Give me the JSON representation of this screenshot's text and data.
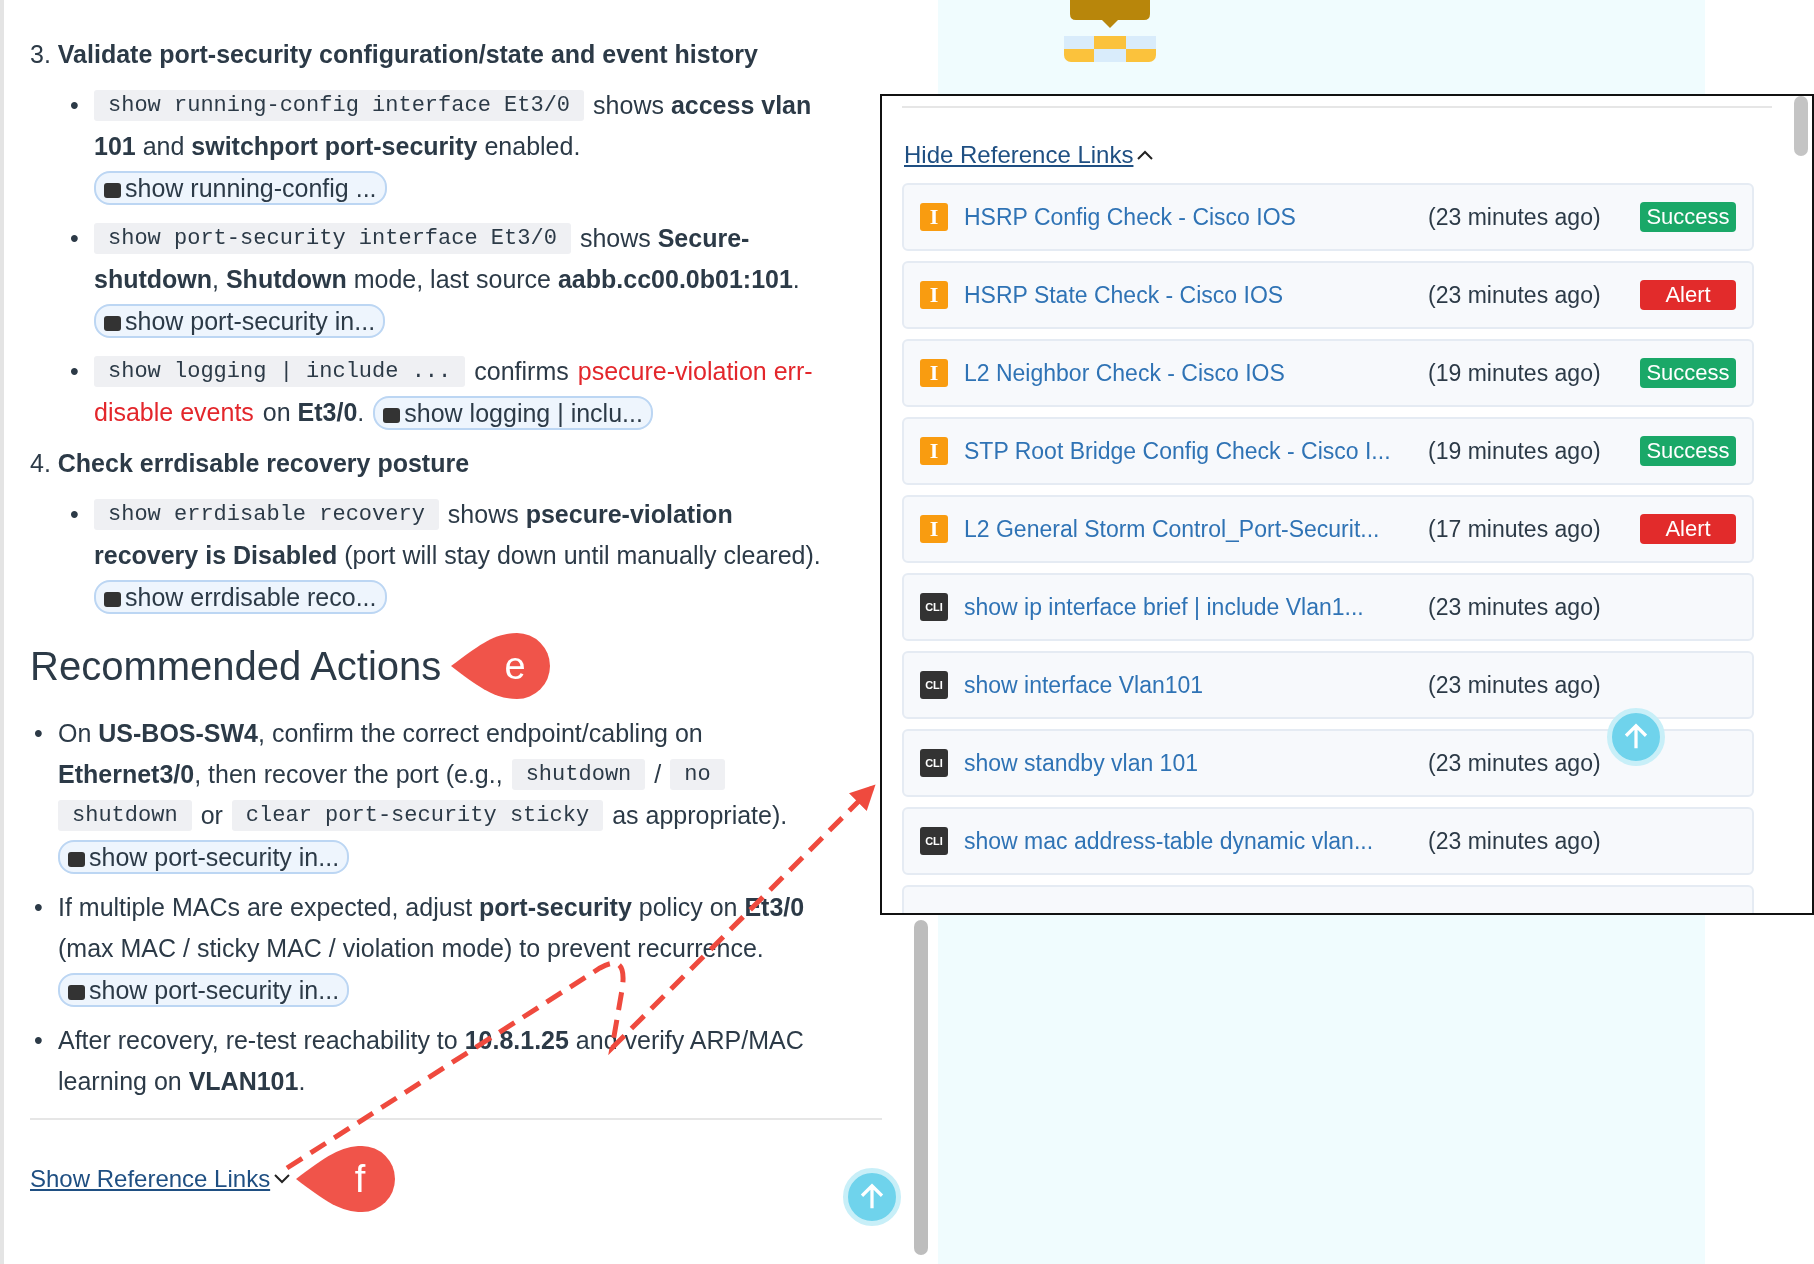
{
  "steps": [
    {
      "number": "3.",
      "title": "Validate port-security configuration/state and event history",
      "bullets": [
        {
          "marker": "•",
          "lines": [
            [
              {
                "kind": "code",
                "text": "show running-config interface Et3/0"
              },
              {
                "kind": "text",
                "text": "shows **access vlan**"
              }
            ],
            [
              {
                "kind": "text",
                "text": "**101** and **switchport port-security** enabled."
              }
            ],
            [
              {
                "kind": "chip",
                "text": "show running-config ..."
              }
            ]
          ]
        },
        {
          "marker": "•",
          "lines": [
            [
              {
                "kind": "code",
                "text": "show port-security interface Et3/0"
              },
              {
                "kind": "text",
                "text": "shows **Secure-**"
              }
            ],
            [
              {
                "kind": "text",
                "text": "**shutdown**, **Shutdown** mode, last source **aabb.cc00.0b01:101**."
              }
            ],
            [
              {
                "kind": "chip",
                "text": "show port-security in..."
              }
            ]
          ]
        },
        {
          "marker": "•",
          "lines": [
            [
              {
                "kind": "code",
                "text": "show logging | include ..."
              },
              {
                "kind": "text",
                "text": "confirms"
              },
              {
                "kind": "alert",
                "text": "psecure-violation err-"
              }
            ],
            [
              {
                "kind": "alert",
                "text": "disable events"
              },
              {
                "kind": "text",
                "text": "on **Et3/0**."
              },
              {
                "kind": "chip",
                "text": "show logging | inclu..."
              }
            ]
          ]
        }
      ]
    },
    {
      "number": "4.",
      "title": "Check errdisable recovery posture",
      "bullets": [
        {
          "marker": "•",
          "lines": [
            [
              {
                "kind": "code",
                "text": "show errdisable recovery"
              },
              {
                "kind": "text",
                "text": "shows **psecure-violation**"
              }
            ],
            [
              {
                "kind": "text",
                "text": "**recovery is Disabled** (port will stay down until manually cleared)."
              }
            ],
            [
              {
                "kind": "chip",
                "text": "show errdisable reco..."
              }
            ]
          ]
        }
      ]
    }
  ],
  "actions": {
    "heading": "Recommended Actions",
    "callout": "e",
    "bullets": [
      {
        "marker": "•",
        "lines": [
          [
            {
              "kind": "text",
              "text": "On **US-BOS-SW4**, confirm the correct endpoint/cabling on"
            }
          ],
          [
            {
              "kind": "text",
              "text": "**Ethernet3/0**, then recover the port (e.g.,"
            },
            {
              "kind": "code",
              "text": "shutdown"
            },
            {
              "kind": "text",
              "text": "/"
            },
            {
              "kind": "code",
              "text": "no"
            }
          ],
          [
            {
              "kind": "code",
              "text": "shutdown"
            },
            {
              "kind": "text",
              "text": "or"
            },
            {
              "kind": "code",
              "text": "clear port-security sticky"
            },
            {
              "kind": "text",
              "text": "as appropriate)."
            }
          ],
          [
            {
              "kind": "chip",
              "text": "show port-security in..."
            }
          ]
        ]
      },
      {
        "marker": "•",
        "lines": [
          [
            {
              "kind": "text",
              "text": "If multiple MACs are expected, adjust **port-security** policy on **Et3/0**"
            }
          ],
          [
            {
              "kind": "text",
              "text": "(max MAC / sticky MAC / violation mode) to prevent recurrence."
            }
          ],
          [
            {
              "kind": "chip",
              "text": "show port-security in..."
            }
          ]
        ]
      },
      {
        "marker": "•",
        "lines": [
          [
            {
              "kind": "text",
              "text": "After recovery, re-test reachability to **10.8.1.25** and verify ARP/MAC"
            }
          ],
          [
            {
              "kind": "text",
              "text": "learning on **VLAN101**."
            }
          ]
        ]
      }
    ]
  },
  "show_links": {
    "label": "Show Reference Links",
    "callout": "f"
  },
  "panel": {
    "toggle": "Hide Reference Links",
    "links": [
      {
        "kind": "check",
        "badge": "I",
        "title": "HSRP Config Check - Cisco IOS",
        "time": "(23 minutes ago)",
        "status": "Success",
        "color": "#1aa868"
      },
      {
        "kind": "check",
        "badge": "I",
        "title": "HSRP State Check - Cisco IOS",
        "time": "(23 minutes ago)",
        "status": "Alert",
        "color": "#e22b2b"
      },
      {
        "kind": "check",
        "badge": "I",
        "title": "L2 Neighbor Check - Cisco IOS",
        "time": "(19 minutes ago)",
        "status": "Success",
        "color": "#1aa868"
      },
      {
        "kind": "check",
        "badge": "I",
        "title": "STP Root Bridge Config Check - Cisco I...",
        "time": "(19 minutes ago)",
        "status": "Success",
        "color": "#1aa868"
      },
      {
        "kind": "check",
        "badge": "I",
        "title": "L2 General Storm Control_Port-Securit...",
        "time": "(17 minutes ago)",
        "status": "Alert",
        "color": "#e22b2b"
      },
      {
        "kind": "cli",
        "badge": "CLI",
        "title": "show ip interface brief | include Vlan1...",
        "time": "(23 minutes ago)"
      },
      {
        "kind": "cli",
        "badge": "CLI",
        "title": "show interface Vlan101",
        "time": "(23 minutes ago)"
      },
      {
        "kind": "cli",
        "badge": "CLI",
        "title": "show standby vlan 101",
        "time": "(23 minutes ago)"
      },
      {
        "kind": "cli",
        "badge": "CLI",
        "title": "show mac address-table dynamic vlan...",
        "time": "(23 minutes ago)"
      }
    ]
  }
}
